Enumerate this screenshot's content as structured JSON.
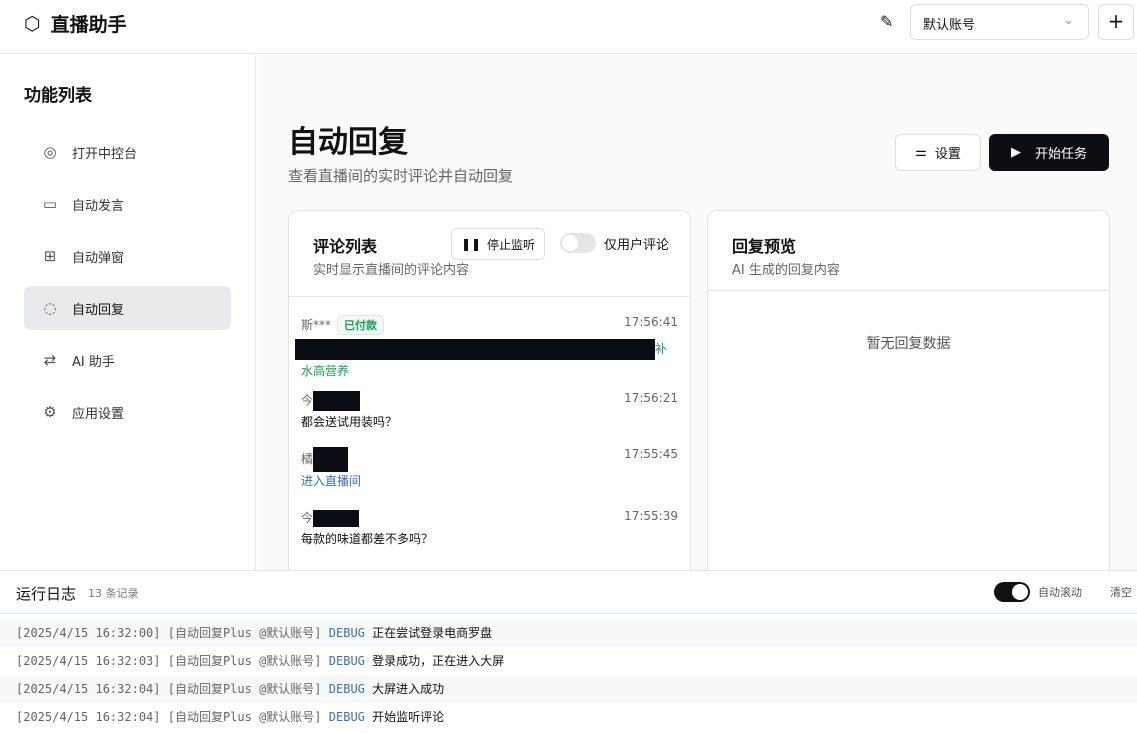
{
  "app": {
    "title": "直播助手",
    "account": "默认账号"
  },
  "sidebar": {
    "heading": "功能列表",
    "items": [
      {
        "label": "打开中控台",
        "icon": "globe-icon"
      },
      {
        "label": "自动发言",
        "icon": "message-icon"
      },
      {
        "label": "自动弹窗",
        "icon": "puzzle-icon"
      },
      {
        "label": "自动回复",
        "icon": "reply-icon",
        "active": true
      },
      {
        "label": "AI 助手",
        "icon": "ai-icon"
      },
      {
        "label": "应用设置",
        "icon": "gear-icon"
      }
    ]
  },
  "page": {
    "title": "自动回复",
    "subtitle": "查看直播间的实时评论并自动回复",
    "settings_label": "设置",
    "start_label": "开始任务"
  },
  "comments": {
    "title": "评论列表",
    "subtitle": "实时显示直播间的评论内容",
    "stop_label": "停止监听",
    "toggle_label": "仅用户评论",
    "items": [
      {
        "user": "斯***",
        "badge": "已付款",
        "time": "17:56:41",
        "text_tail": "补",
        "text": "水高营养"
      },
      {
        "user": "今",
        "time": "17:56:21",
        "text": "都会送试用装吗？"
      },
      {
        "user": "橘",
        "time": "17:55:45",
        "text": "进入直播间"
      },
      {
        "user": "今",
        "time": "17:55:39",
        "text": "每款的味道都差不多吗？"
      }
    ]
  },
  "preview": {
    "title": "回复预览",
    "subtitle": "AI 生成的回复内容",
    "empty": "暂无回复数据"
  },
  "log": {
    "title": "运行日志",
    "count": "13 条记录",
    "autoscroll": "自动滚动",
    "clear": "清空",
    "rows": [
      {
        "ts": "[2025/4/15 16:32:00]",
        "src": "[自动回复Plus @默认账号]",
        "level": "DEBUG",
        "msg": "正在尝试登录电商罗盘"
      },
      {
        "ts": "[2025/4/15 16:32:03]",
        "src": "[自动回复Plus @默认账号]",
        "level": "DEBUG",
        "msg": "登录成功，正在进入大屏"
      },
      {
        "ts": "[2025/4/15 16:32:04]",
        "src": "[自动回复Plus @默认账号]",
        "level": "DEBUG",
        "msg": "大屏进入成功"
      },
      {
        "ts": "[2025/4/15 16:32:04]",
        "src": "[自动回复Plus @默认账号]",
        "level": "DEBUG",
        "msg": "开始监听评论"
      }
    ]
  }
}
